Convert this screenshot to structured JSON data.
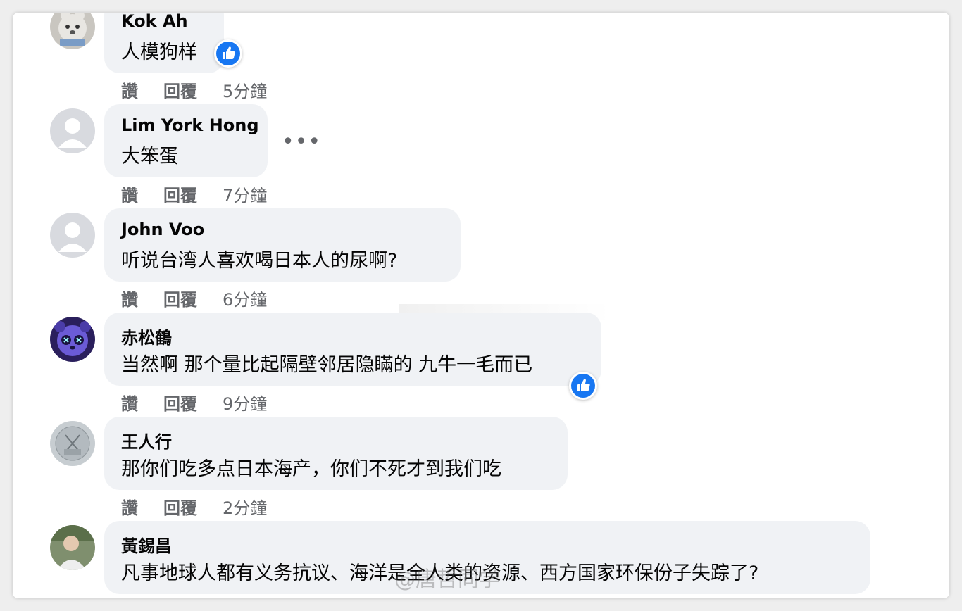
{
  "actions": {
    "like_label": "讚",
    "reply_label": "回覆"
  },
  "comments": [
    {
      "author": "Kok Ah",
      "text": "人模狗样",
      "time": "5分鐘"
    },
    {
      "author": "Lim York Hong",
      "text": "大笨蛋",
      "time": "7分鐘",
      "more": "•••"
    },
    {
      "author": "John Voo",
      "text": "听说台湾人喜欢喝日本人的尿啊?",
      "time": "6分鐘"
    },
    {
      "author": "赤松鶴",
      "text": "当然啊 那个量比起隔壁邻居隐瞞的 九牛一毛而已",
      "time": "9分鐘"
    },
    {
      "author": "王人行",
      "text": "那你们吃多点日本海产，你们不死才到我们吃",
      "time": "2分鐘"
    },
    {
      "author": "黃錫昌",
      "text": "凡事地球人都有义务抗议、海洋是全人类的资源、西方国家环保份子失踪了?"
    }
  ],
  "watermark": "@唐哲同学",
  "colors": {
    "bubble": "#f0f2f5",
    "accent": "#1877f2",
    "muted": "#65676b"
  }
}
